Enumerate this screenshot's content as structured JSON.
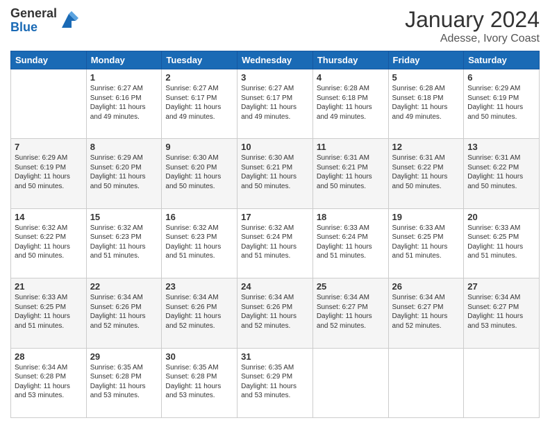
{
  "header": {
    "logo_general": "General",
    "logo_blue": "Blue",
    "month_title": "January 2024",
    "location": "Adesse, Ivory Coast"
  },
  "days_of_week": [
    "Sunday",
    "Monday",
    "Tuesday",
    "Wednesday",
    "Thursday",
    "Friday",
    "Saturday"
  ],
  "weeks": [
    [
      {
        "day": "",
        "sunrise": "",
        "sunset": "",
        "daylight": ""
      },
      {
        "day": "1",
        "sunrise": "Sunrise: 6:27 AM",
        "sunset": "Sunset: 6:16 PM",
        "daylight": "Daylight: 11 hours and 49 minutes."
      },
      {
        "day": "2",
        "sunrise": "Sunrise: 6:27 AM",
        "sunset": "Sunset: 6:17 PM",
        "daylight": "Daylight: 11 hours and 49 minutes."
      },
      {
        "day": "3",
        "sunrise": "Sunrise: 6:27 AM",
        "sunset": "Sunset: 6:17 PM",
        "daylight": "Daylight: 11 hours and 49 minutes."
      },
      {
        "day": "4",
        "sunrise": "Sunrise: 6:28 AM",
        "sunset": "Sunset: 6:18 PM",
        "daylight": "Daylight: 11 hours and 49 minutes."
      },
      {
        "day": "5",
        "sunrise": "Sunrise: 6:28 AM",
        "sunset": "Sunset: 6:18 PM",
        "daylight": "Daylight: 11 hours and 49 minutes."
      },
      {
        "day": "6",
        "sunrise": "Sunrise: 6:29 AM",
        "sunset": "Sunset: 6:19 PM",
        "daylight": "Daylight: 11 hours and 50 minutes."
      }
    ],
    [
      {
        "day": "7",
        "sunrise": "Sunrise: 6:29 AM",
        "sunset": "Sunset: 6:19 PM",
        "daylight": "Daylight: 11 hours and 50 minutes."
      },
      {
        "day": "8",
        "sunrise": "Sunrise: 6:29 AM",
        "sunset": "Sunset: 6:20 PM",
        "daylight": "Daylight: 11 hours and 50 minutes."
      },
      {
        "day": "9",
        "sunrise": "Sunrise: 6:30 AM",
        "sunset": "Sunset: 6:20 PM",
        "daylight": "Daylight: 11 hours and 50 minutes."
      },
      {
        "day": "10",
        "sunrise": "Sunrise: 6:30 AM",
        "sunset": "Sunset: 6:21 PM",
        "daylight": "Daylight: 11 hours and 50 minutes."
      },
      {
        "day": "11",
        "sunrise": "Sunrise: 6:31 AM",
        "sunset": "Sunset: 6:21 PM",
        "daylight": "Daylight: 11 hours and 50 minutes."
      },
      {
        "day": "12",
        "sunrise": "Sunrise: 6:31 AM",
        "sunset": "Sunset: 6:22 PM",
        "daylight": "Daylight: 11 hours and 50 minutes."
      },
      {
        "day": "13",
        "sunrise": "Sunrise: 6:31 AM",
        "sunset": "Sunset: 6:22 PM",
        "daylight": "Daylight: 11 hours and 50 minutes."
      }
    ],
    [
      {
        "day": "14",
        "sunrise": "Sunrise: 6:32 AM",
        "sunset": "Sunset: 6:22 PM",
        "daylight": "Daylight: 11 hours and 50 minutes."
      },
      {
        "day": "15",
        "sunrise": "Sunrise: 6:32 AM",
        "sunset": "Sunset: 6:23 PM",
        "daylight": "Daylight: 11 hours and 51 minutes."
      },
      {
        "day": "16",
        "sunrise": "Sunrise: 6:32 AM",
        "sunset": "Sunset: 6:23 PM",
        "daylight": "Daylight: 11 hours and 51 minutes."
      },
      {
        "day": "17",
        "sunrise": "Sunrise: 6:32 AM",
        "sunset": "Sunset: 6:24 PM",
        "daylight": "Daylight: 11 hours and 51 minutes."
      },
      {
        "day": "18",
        "sunrise": "Sunrise: 6:33 AM",
        "sunset": "Sunset: 6:24 PM",
        "daylight": "Daylight: 11 hours and 51 minutes."
      },
      {
        "day": "19",
        "sunrise": "Sunrise: 6:33 AM",
        "sunset": "Sunset: 6:25 PM",
        "daylight": "Daylight: 11 hours and 51 minutes."
      },
      {
        "day": "20",
        "sunrise": "Sunrise: 6:33 AM",
        "sunset": "Sunset: 6:25 PM",
        "daylight": "Daylight: 11 hours and 51 minutes."
      }
    ],
    [
      {
        "day": "21",
        "sunrise": "Sunrise: 6:33 AM",
        "sunset": "Sunset: 6:25 PM",
        "daylight": "Daylight: 11 hours and 51 minutes."
      },
      {
        "day": "22",
        "sunrise": "Sunrise: 6:34 AM",
        "sunset": "Sunset: 6:26 PM",
        "daylight": "Daylight: 11 hours and 52 minutes."
      },
      {
        "day": "23",
        "sunrise": "Sunrise: 6:34 AM",
        "sunset": "Sunset: 6:26 PM",
        "daylight": "Daylight: 11 hours and 52 minutes."
      },
      {
        "day": "24",
        "sunrise": "Sunrise: 6:34 AM",
        "sunset": "Sunset: 6:26 PM",
        "daylight": "Daylight: 11 hours and 52 minutes."
      },
      {
        "day": "25",
        "sunrise": "Sunrise: 6:34 AM",
        "sunset": "Sunset: 6:27 PM",
        "daylight": "Daylight: 11 hours and 52 minutes."
      },
      {
        "day": "26",
        "sunrise": "Sunrise: 6:34 AM",
        "sunset": "Sunset: 6:27 PM",
        "daylight": "Daylight: 11 hours and 52 minutes."
      },
      {
        "day": "27",
        "sunrise": "Sunrise: 6:34 AM",
        "sunset": "Sunset: 6:27 PM",
        "daylight": "Daylight: 11 hours and 53 minutes."
      }
    ],
    [
      {
        "day": "28",
        "sunrise": "Sunrise: 6:34 AM",
        "sunset": "Sunset: 6:28 PM",
        "daylight": "Daylight: 11 hours and 53 minutes."
      },
      {
        "day": "29",
        "sunrise": "Sunrise: 6:35 AM",
        "sunset": "Sunset: 6:28 PM",
        "daylight": "Daylight: 11 hours and 53 minutes."
      },
      {
        "day": "30",
        "sunrise": "Sunrise: 6:35 AM",
        "sunset": "Sunset: 6:28 PM",
        "daylight": "Daylight: 11 hours and 53 minutes."
      },
      {
        "day": "31",
        "sunrise": "Sunrise: 6:35 AM",
        "sunset": "Sunset: 6:29 PM",
        "daylight": "Daylight: 11 hours and 53 minutes."
      },
      {
        "day": "",
        "sunrise": "",
        "sunset": "",
        "daylight": ""
      },
      {
        "day": "",
        "sunrise": "",
        "sunset": "",
        "daylight": ""
      },
      {
        "day": "",
        "sunrise": "",
        "sunset": "",
        "daylight": ""
      }
    ]
  ]
}
